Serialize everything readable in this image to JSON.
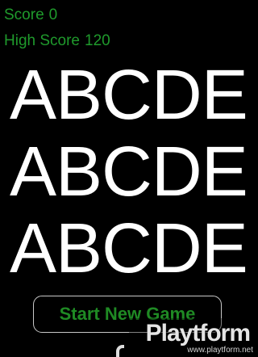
{
  "hud": {
    "score_label": "Score",
    "score_value": "0",
    "high_score_label": "High Score",
    "high_score_value": "120"
  },
  "letter_rows": [
    "ABCDE",
    "ABCDE",
    "ABCDE"
  ],
  "start_button": {
    "label": "Start New Game"
  },
  "watermark": {
    "logo": "Playtform",
    "url": "www.playtform.net"
  },
  "colors": {
    "background": "#000000",
    "hud_text": "#1f9a2c",
    "letters": "#ffffff",
    "button_text": "#1f8a24",
    "button_border": "#c8c8c8"
  }
}
